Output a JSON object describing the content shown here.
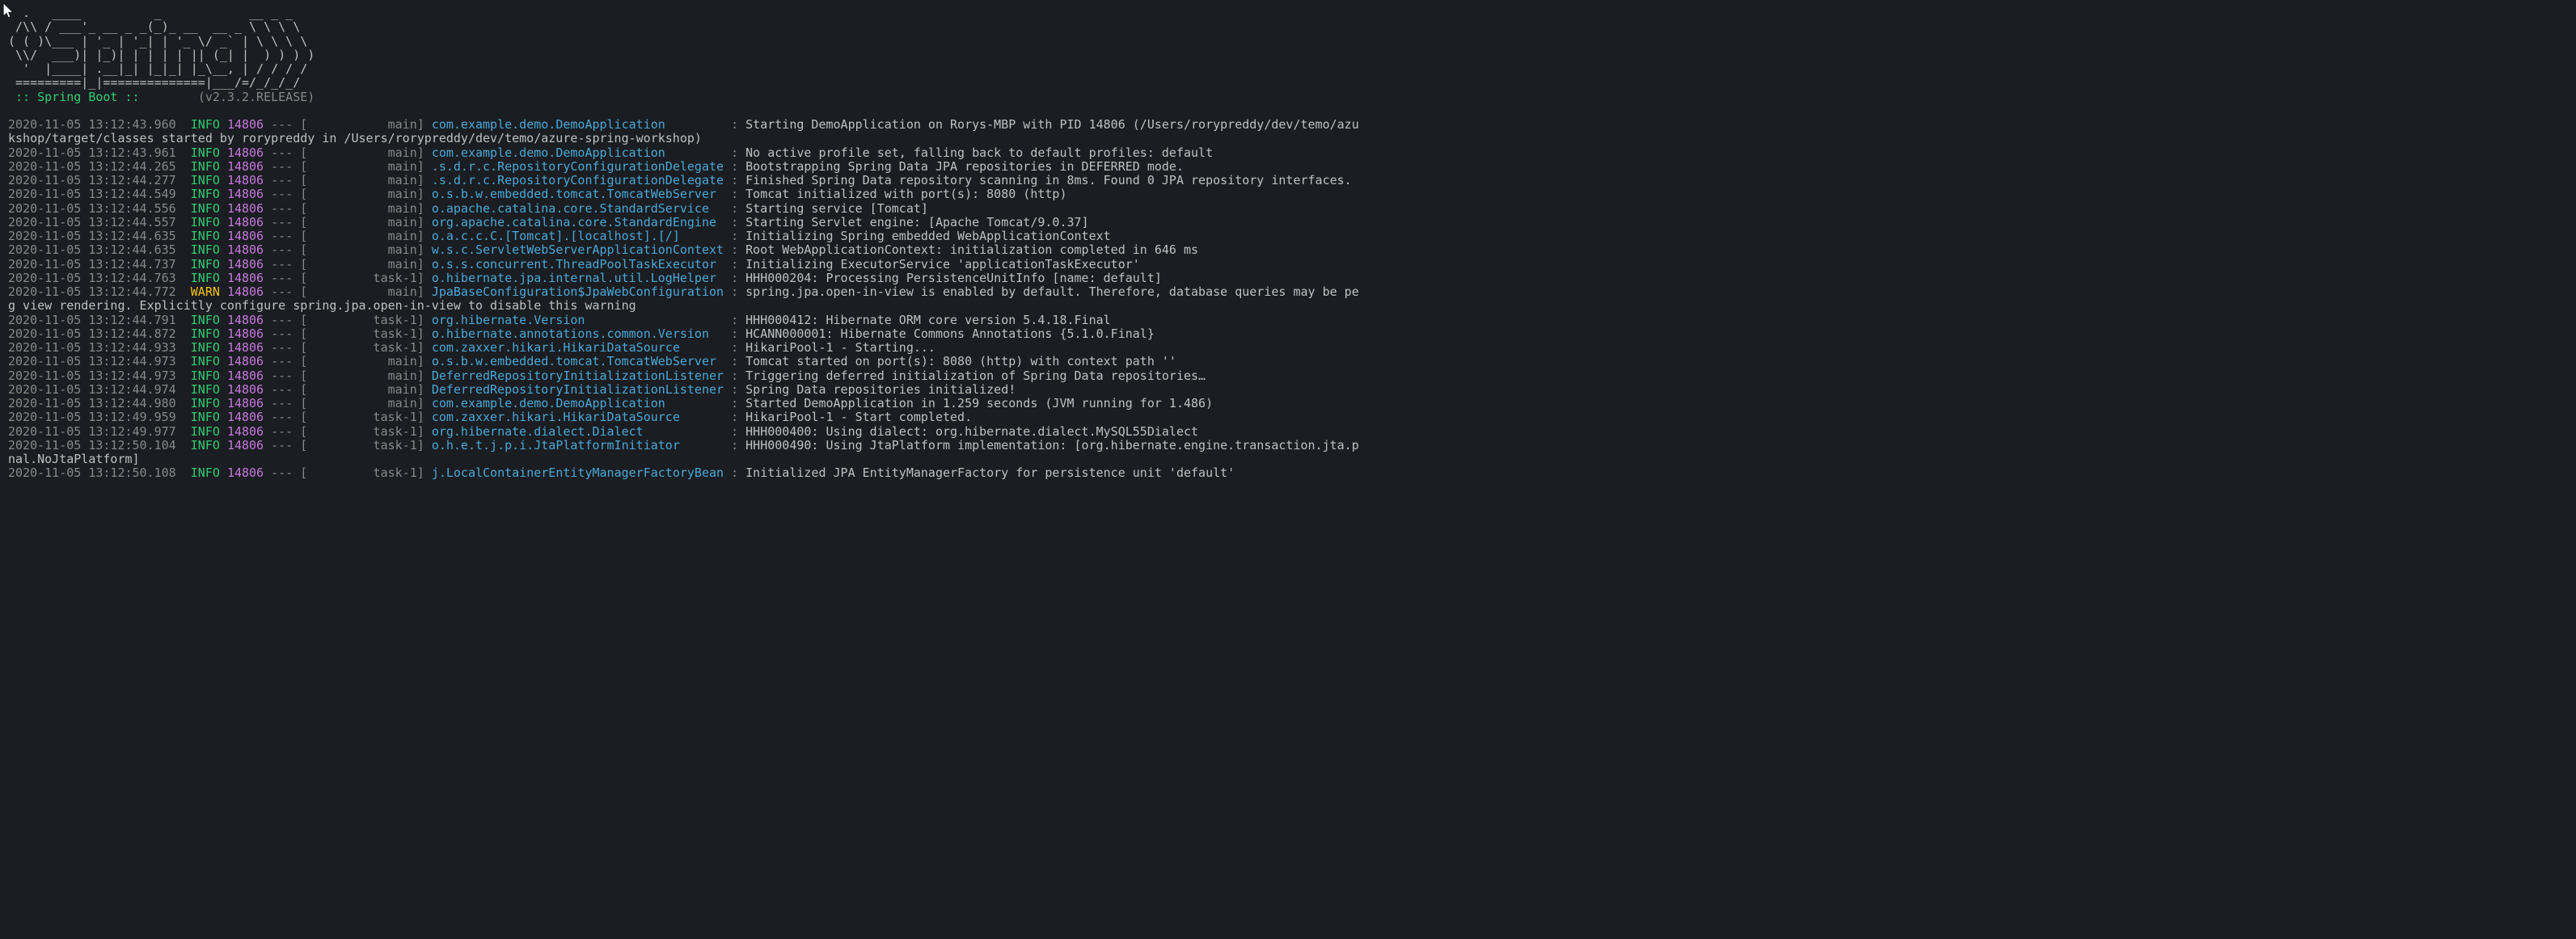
{
  "ascii_art": "  .   ____          _            __ _ _\n /\\\\ / ___'_ __ _ _(_)_ __  __ _ \\ \\ \\ \\\n( ( )\\___ | '_ | '_| | '_ \\/ _` | \\ \\ \\ \\\n \\\\/  ___)| |_)| | | | | || (_| |  ) ) ) )\n  '  |____| .__|_| |_|_| |_\\__, | / / / /\n =========|_|==============|___/=/_/_/_/",
  "banner": {
    "label": " :: Spring Boot :: ",
    "spacer": "       ",
    "version": "(v2.3.2.RELEASE)"
  },
  "log_lines": [
    {
      "ts": "2020-11-05 13:12:43.960",
      "level": "INFO",
      "pid": "14806",
      "thread": "           main",
      "logger": "com.example.demo.DemoApplication        ",
      "msg": "Starting DemoApplication on Rorys-MBP with PID 14806 (/Users/rorypreddy/dev/temo/azu",
      "wrap": "kshop/target/classes started by rorypreddy in /Users/rorypreddy/dev/temo/azure-spring-workshop)"
    },
    {
      "ts": "2020-11-05 13:12:43.961",
      "level": "INFO",
      "pid": "14806",
      "thread": "           main",
      "logger": "com.example.demo.DemoApplication        ",
      "msg": "No active profile set, falling back to default profiles: default"
    },
    {
      "ts": "2020-11-05 13:12:44.265",
      "level": "INFO",
      "pid": "14806",
      "thread": "           main",
      "logger": ".s.d.r.c.RepositoryConfigurationDelegate",
      "msg": "Bootstrapping Spring Data JPA repositories in DEFERRED mode."
    },
    {
      "ts": "2020-11-05 13:12:44.277",
      "level": "INFO",
      "pid": "14806",
      "thread": "           main",
      "logger": ".s.d.r.c.RepositoryConfigurationDelegate",
      "msg": "Finished Spring Data repository scanning in 8ms. Found 0 JPA repository interfaces."
    },
    {
      "ts": "2020-11-05 13:12:44.549",
      "level": "INFO",
      "pid": "14806",
      "thread": "           main",
      "logger": "o.s.b.w.embedded.tomcat.TomcatWebServer ",
      "msg": "Tomcat initialized with port(s): 8080 (http)"
    },
    {
      "ts": "2020-11-05 13:12:44.556",
      "level": "INFO",
      "pid": "14806",
      "thread": "           main",
      "logger": "o.apache.catalina.core.StandardService  ",
      "msg": "Starting service [Tomcat]"
    },
    {
      "ts": "2020-11-05 13:12:44.557",
      "level": "INFO",
      "pid": "14806",
      "thread": "           main",
      "logger": "org.apache.catalina.core.StandardEngine ",
      "msg": "Starting Servlet engine: [Apache Tomcat/9.0.37]"
    },
    {
      "ts": "2020-11-05 13:12:44.635",
      "level": "INFO",
      "pid": "14806",
      "thread": "           main",
      "logger": "o.a.c.c.C.[Tomcat].[localhost].[/]      ",
      "msg": "Initializing Spring embedded WebApplicationContext"
    },
    {
      "ts": "2020-11-05 13:12:44.635",
      "level": "INFO",
      "pid": "14806",
      "thread": "           main",
      "logger": "w.s.c.ServletWebServerApplicationContext",
      "msg": "Root WebApplicationContext: initialization completed in 646 ms"
    },
    {
      "ts": "2020-11-05 13:12:44.737",
      "level": "INFO",
      "pid": "14806",
      "thread": "           main",
      "logger": "o.s.s.concurrent.ThreadPoolTaskExecutor ",
      "msg": "Initializing ExecutorService 'applicationTaskExecutor'"
    },
    {
      "ts": "2020-11-05 13:12:44.763",
      "level": "INFO",
      "pid": "14806",
      "thread": "         task-1",
      "logger": "o.hibernate.jpa.internal.util.LogHelper ",
      "msg": "HHH000204: Processing PersistenceUnitInfo [name: default]"
    },
    {
      "ts": "2020-11-05 13:12:44.772",
      "level": "WARN",
      "pid": "14806",
      "thread": "           main",
      "logger": "JpaBaseConfiguration$JpaWebConfiguration",
      "msg": "spring.jpa.open-in-view is enabled by default. Therefore, database queries may be pe",
      "wrap": "g view rendering. Explicitly configure spring.jpa.open-in-view to disable this warning"
    },
    {
      "ts": "2020-11-05 13:12:44.791",
      "level": "INFO",
      "pid": "14806",
      "thread": "         task-1",
      "logger": "org.hibernate.Version                   ",
      "msg": "HHH000412: Hibernate ORM core version 5.4.18.Final"
    },
    {
      "ts": "2020-11-05 13:12:44.872",
      "level": "INFO",
      "pid": "14806",
      "thread": "         task-1",
      "logger": "o.hibernate.annotations.common.Version  ",
      "msg": "HCANN000001: Hibernate Commons Annotations {5.1.0.Final}"
    },
    {
      "ts": "2020-11-05 13:12:44.933",
      "level": "INFO",
      "pid": "14806",
      "thread": "         task-1",
      "logger": "com.zaxxer.hikari.HikariDataSource      ",
      "msg": "HikariPool-1 - Starting..."
    },
    {
      "ts": "2020-11-05 13:12:44.973",
      "level": "INFO",
      "pid": "14806",
      "thread": "           main",
      "logger": "o.s.b.w.embedded.tomcat.TomcatWebServer ",
      "msg": "Tomcat started on port(s): 8080 (http) with context path ''"
    },
    {
      "ts": "2020-11-05 13:12:44.973",
      "level": "INFO",
      "pid": "14806",
      "thread": "           main",
      "logger": "DeferredRepositoryInitializationListener",
      "msg": "Triggering deferred initialization of Spring Data repositories…"
    },
    {
      "ts": "2020-11-05 13:12:44.974",
      "level": "INFO",
      "pid": "14806",
      "thread": "           main",
      "logger": "DeferredRepositoryInitializationListener",
      "msg": "Spring Data repositories initialized!"
    },
    {
      "ts": "2020-11-05 13:12:44.980",
      "level": "INFO",
      "pid": "14806",
      "thread": "           main",
      "logger": "com.example.demo.DemoApplication        ",
      "msg": "Started DemoApplication in 1.259 seconds (JVM running for 1.486)"
    },
    {
      "ts": "2020-11-05 13:12:49.959",
      "level": "INFO",
      "pid": "14806",
      "thread": "         task-1",
      "logger": "com.zaxxer.hikari.HikariDataSource      ",
      "msg": "HikariPool-1 - Start completed."
    },
    {
      "ts": "2020-11-05 13:12:49.977",
      "level": "INFO",
      "pid": "14806",
      "thread": "         task-1",
      "logger": "org.hibernate.dialect.Dialect           ",
      "msg": "HHH000400: Using dialect: org.hibernate.dialect.MySQL55Dialect"
    },
    {
      "ts": "2020-11-05 13:12:50.104",
      "level": "INFO",
      "pid": "14806",
      "thread": "         task-1",
      "logger": "o.h.e.t.j.p.i.JtaPlatformInitiator      ",
      "msg": "HHH000490: Using JtaPlatform implementation: [org.hibernate.engine.transaction.jta.p",
      "wrap": "nal.NoJtaPlatform]"
    },
    {
      "ts": "2020-11-05 13:12:50.108",
      "level": "INFO",
      "pid": "14806",
      "thread": "         task-1",
      "logger": "j.LocalContainerEntityManagerFactoryBean",
      "msg": "Initialized JPA EntityManagerFactory for persistence unit 'default'"
    }
  ]
}
